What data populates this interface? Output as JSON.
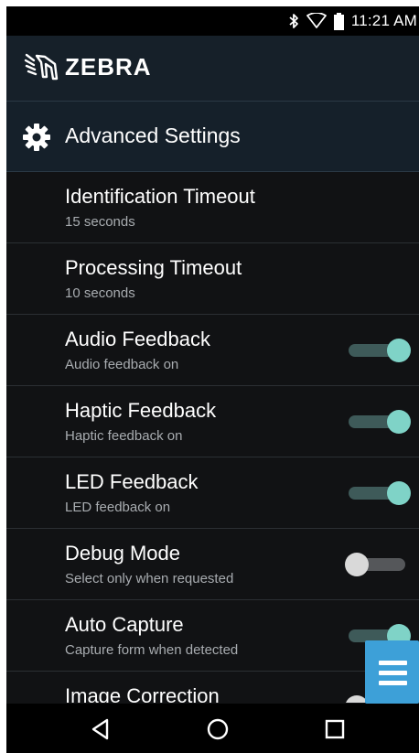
{
  "status_bar": {
    "time": "11:21 AM",
    "icons": [
      "bluetooth-icon",
      "wifi-icon",
      "battery-icon"
    ]
  },
  "header": {
    "brand": "ZEBRA"
  },
  "section": {
    "title": "Advanced Settings",
    "icon": "gear-icon"
  },
  "settings": [
    {
      "title": "Identification Timeout",
      "subtitle": "15 seconds",
      "toggle": null
    },
    {
      "title": "Processing Timeout",
      "subtitle": "10 seconds",
      "toggle": null
    },
    {
      "title": "Audio Feedback",
      "subtitle": "Audio feedback on",
      "toggle": true
    },
    {
      "title": "Haptic Feedback",
      "subtitle": "Haptic feedback on",
      "toggle": true
    },
    {
      "title": "LED Feedback",
      "subtitle": "LED feedback on",
      "toggle": true
    },
    {
      "title": "Debug Mode",
      "subtitle": "Select only when requested",
      "toggle": false
    },
    {
      "title": "Auto Capture",
      "subtitle": "Capture form when detected",
      "toggle": true
    },
    {
      "title": "Image Correction",
      "subtitle": "",
      "toggle": false
    }
  ],
  "fab": {
    "icon": "menu-icon"
  },
  "navbar": {
    "icons": [
      "back-icon",
      "home-icon",
      "recents-icon"
    ]
  },
  "colors": {
    "toggle_on_thumb": "#7fd3c7",
    "toggle_on_track": "#3e5a59",
    "fab": "#3da0d8"
  }
}
